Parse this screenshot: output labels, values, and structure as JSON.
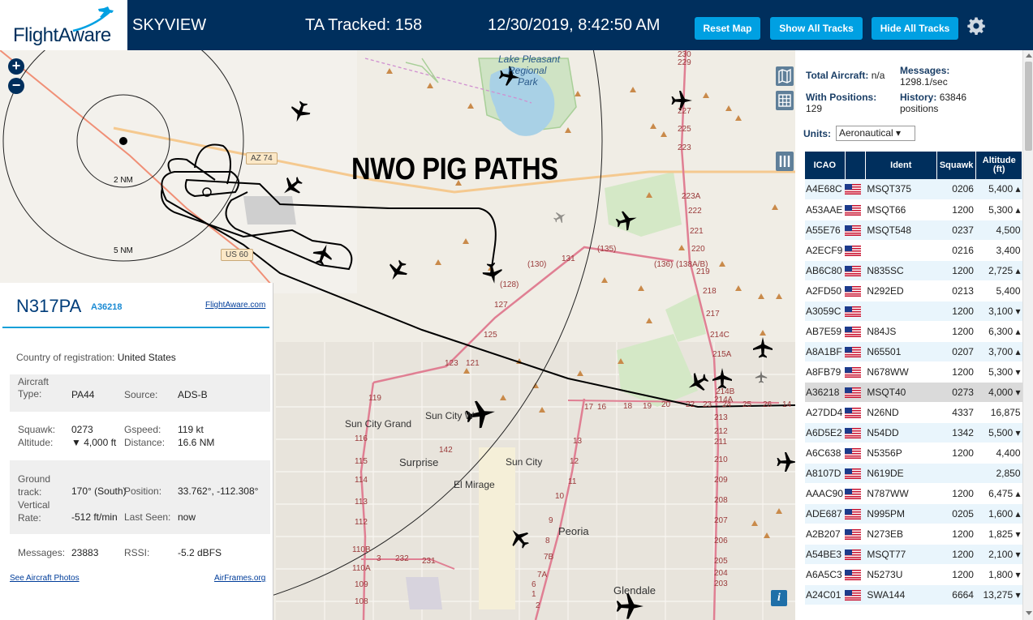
{
  "header": {
    "logo_text": "FlightAware",
    "app_name": "SKYVIEW",
    "tracked": "TA Tracked: 158",
    "datetime": "12/30/2019, 8:42:50 AM",
    "buttons": {
      "reset": "Reset Map",
      "show_all": "Show All Tracks",
      "hide_all": "Hide All Tracks"
    },
    "colors": {
      "bar": "#002f5d",
      "button": "#00a0e2"
    }
  },
  "map": {
    "overlay_text": "NWO PIG PATHS",
    "zoom_in": "+",
    "zoom_out": "−",
    "range_rings": [
      "2 NM",
      "5 NM"
    ],
    "info": "i",
    "places": {
      "lake_pleasant": "Lake Pleasant",
      "regional": "Regional",
      "park": "Park",
      "sun_city_grand": "Sun City Grand",
      "sun_city_w": "Sun City W",
      "surprise": "Surprise",
      "sun_city": "Sun City",
      "el_mirage": "El Mirage",
      "peoria": "Peoria",
      "glendale": "Glendale"
    },
    "highways": {
      "az74": "AZ 74",
      "us60": "US 60"
    },
    "road_labels": [
      "(130)",
      "131",
      "(135)",
      "(136)",
      "(138A/B)",
      "(128)",
      "127",
      "125",
      "123",
      "121",
      "119",
      "116",
      "115",
      "114",
      "113",
      "112",
      "110B",
      "110A",
      "109",
      "108",
      "142",
      "17",
      "16",
      "18",
      "19",
      "20",
      "22",
      "23",
      "24",
      "25",
      "26",
      "14",
      "13",
      "12",
      "11",
      "10",
      "9",
      "8",
      "7B",
      "7A",
      "6",
      "1",
      "2",
      "3",
      "232",
      "231",
      "230",
      "229",
      "227",
      "225",
      "223",
      "223A",
      "222",
      "221",
      "220",
      "219",
      "218",
      "217",
      "214C",
      "215A",
      "214B",
      "214A",
      "213",
      "212",
      "211",
      "210",
      "209",
      "208",
      "207",
      "206",
      "205",
      "204",
      "203"
    ]
  },
  "selected": {
    "callsign": "N317PA",
    "hex": "A36218",
    "flightaware_link": "FlightAware.com",
    "country_label": "Country of registration:",
    "country": "United States",
    "aircraft_type_label": "Aircraft\nType:",
    "aircraft_type": "PA44",
    "source_label": "Source:",
    "source": "ADS-B",
    "squawk_label": "Squawk:",
    "squawk": "0273",
    "gspeed_label": "Gspeed:",
    "gspeed": "119 kt",
    "altitude_label": "Altitude:",
    "altitude": "▼ 4,000 ft",
    "distance_label": "Distance:",
    "distance": "16.6 NM",
    "ground_track_label": "Ground\ntrack:",
    "ground_track": "170° (South)",
    "position_label": "Position:",
    "position": "33.762°, -112.308°",
    "vertical_rate_label": "Vertical\nRate:",
    "vertical_rate": "-512 ft/min",
    "last_seen_label": "Last Seen:",
    "last_seen": "now",
    "messages_label": "Messages:",
    "messages": "23883",
    "rssi_label": "RSSI:",
    "rssi": "-5.2 dBFS",
    "photos_link": "See Aircraft Photos",
    "airframes_link": "AirFrames.org"
  },
  "stats": {
    "total_label": "Total Aircraft:",
    "total": "n/a",
    "messages_label": "Messages:",
    "messages": "1298.1/sec",
    "with_pos_label": "With Positions:",
    "with_pos": "129",
    "history_label": "History:",
    "history": "63846",
    "history_unit": "positions",
    "units_label": "Units:",
    "units_value": "Aeronautical ▾"
  },
  "table": {
    "headers": [
      "ICAO",
      "",
      "Ident",
      "Squawk",
      "Altitude\n(ft)"
    ],
    "rows": [
      {
        "icao": "A4E68C",
        "ident": "MSQT375",
        "squawk": "0206",
        "alt": "5,400 ▴"
      },
      {
        "icao": "A53AAE",
        "ident": "MSQT66",
        "squawk": "1200",
        "alt": "5,300 ▴"
      },
      {
        "icao": "A55E76",
        "ident": "MSQT548",
        "squawk": "0237",
        "alt": "4,500"
      },
      {
        "icao": "A2ECF9",
        "ident": "",
        "squawk": "0216",
        "alt": "3,400"
      },
      {
        "icao": "AB6C80",
        "ident": "N835SC",
        "squawk": "1200",
        "alt": "2,725 ▴"
      },
      {
        "icao": "A2FD50",
        "ident": "N292ED",
        "squawk": "0213",
        "alt": "5,400"
      },
      {
        "icao": "A3059C",
        "ident": "",
        "squawk": "1200",
        "alt": "3,100 ▾"
      },
      {
        "icao": "AB7E59",
        "ident": "N84JS",
        "squawk": "1200",
        "alt": "6,300 ▴"
      },
      {
        "icao": "A8A1BF",
        "ident": "N65501",
        "squawk": "0207",
        "alt": "3,700 ▴"
      },
      {
        "icao": "A8FB79",
        "ident": "N678WW",
        "squawk": "1200",
        "alt": "5,300 ▾"
      },
      {
        "icao": "A36218",
        "ident": "MSQT40",
        "squawk": "0273",
        "alt": "4,000 ▾",
        "selected": true
      },
      {
        "icao": "A27DD4",
        "ident": "N26ND",
        "squawk": "4337",
        "alt": "16,875"
      },
      {
        "icao": "A6D5E2",
        "ident": "N54DD",
        "squawk": "1342",
        "alt": "5,500 ▾"
      },
      {
        "icao": "A6C638",
        "ident": "N5356P",
        "squawk": "1200",
        "alt": "4,400"
      },
      {
        "icao": "A8107D",
        "ident": "N619DE",
        "squawk": "",
        "alt": "2,850"
      },
      {
        "icao": "AAAC90",
        "ident": "N787WW",
        "squawk": "1200",
        "alt": "6,475 ▴"
      },
      {
        "icao": "ADE687",
        "ident": "N995PM",
        "squawk": "0205",
        "alt": "1,600 ▴"
      },
      {
        "icao": "A2B207",
        "ident": "N273EB",
        "squawk": "1200",
        "alt": "1,825 ▾"
      },
      {
        "icao": "A54BE3",
        "ident": "MSQT77",
        "squawk": "1200",
        "alt": "2,100 ▾"
      },
      {
        "icao": "A6A5C3",
        "ident": "N5273U",
        "squawk": "1200",
        "alt": "1,800 ▾"
      },
      {
        "icao": "A24C01",
        "ident": "SWA144",
        "squawk": "6664",
        "alt": "13,275 ▾"
      }
    ]
  }
}
